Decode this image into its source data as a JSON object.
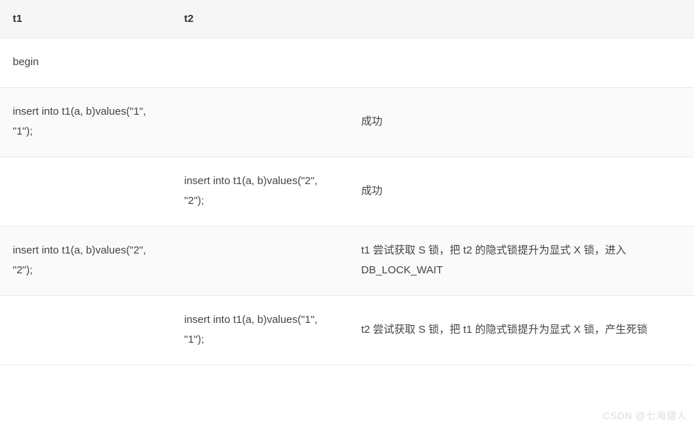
{
  "table": {
    "headers": {
      "t1": "t1",
      "t2": "t2",
      "result": ""
    },
    "rows": [
      {
        "t1": "begin",
        "t2": "",
        "result": ""
      },
      {
        "t1": "insert into t1(a, b)values(\"1\", \"1\");",
        "t2": "",
        "result": "成功"
      },
      {
        "t1": "",
        "t2": "insert into t1(a, b)values(\"2\", \"2\");",
        "result": "成功"
      },
      {
        "t1": "insert into t1(a, b)values(\"2\", \"2\");",
        "t2": "",
        "result": "t1 尝试获取 S 锁，把 t2 的隐式锁提升为显式 X 锁，进入 DB_LOCK_WAIT"
      },
      {
        "t1": "",
        "t2": "insert into t1(a, b)values(\"1\", \"1\");",
        "result": "t2 尝试获取 S 锁，把 t1 的隐式锁提升为显式 X 锁，产生死锁"
      }
    ]
  },
  "watermark": "CSDN @七海健人"
}
